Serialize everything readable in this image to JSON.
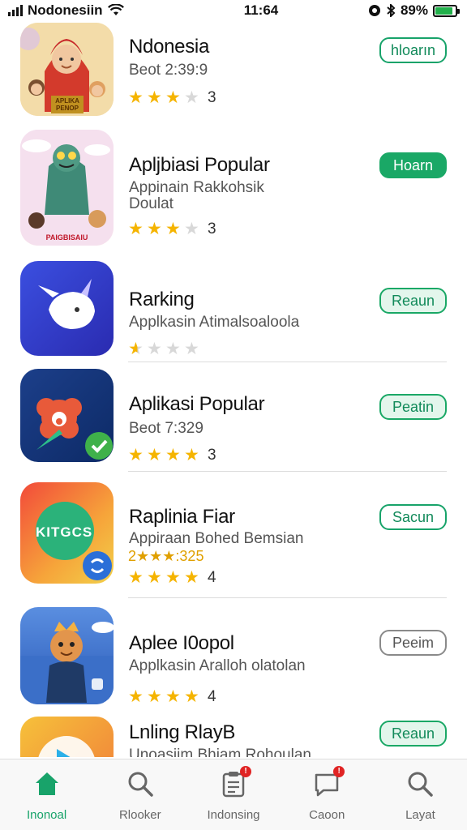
{
  "status_bar": {
    "carrier": "Nodonesiin",
    "time": "11:64",
    "battery": "89%"
  },
  "apps": [
    {
      "title": "Ndonesia",
      "subtitle": "Beot 2:39:9",
      "rating": "3",
      "stars_filled": 3,
      "action_label": "hloarın",
      "icon_text": "APLIKA\nPENOP"
    },
    {
      "title": "Apljbiasi Popular",
      "subtitle": "Appinain Rakkohsik\nDoulat",
      "rating": "3",
      "stars_filled": 3,
      "action_label": "Hoarn",
      "icon_text": "PAIGBISAIU"
    },
    {
      "title": "Rarking",
      "subtitle": "Applkasin Atimalsoaloola",
      "rating": "",
      "stars_filled": 0.5,
      "action_label": "Reaun",
      "icon_text": ""
    },
    {
      "title": "Aplikasi Popular",
      "subtitle": "Beot 7:329",
      "rating": "3",
      "stars_filled": 4,
      "action_label": "Peatin",
      "icon_text": ""
    },
    {
      "title": "Raplinia Fiar",
      "subtitle": "Appiraan Bohed Bemsian",
      "sub_rating": "2★★★:325",
      "rating": "4",
      "stars_filled": 4,
      "action_label": "Sacun",
      "icon_text": "KITGCS"
    },
    {
      "title": "Aplee I0opol",
      "subtitle": "Applkasin Aralloh olatolan",
      "rating": "4",
      "stars_filled": 4,
      "action_label": "Peeim",
      "icon_text": ""
    },
    {
      "title": "Lnling RlayB",
      "subtitle": "Unoasiim Bhiam Rohoulan",
      "rating": "",
      "stars_filled": 0,
      "action_label": "Reaun",
      "icon_text": ""
    }
  ],
  "tabs": [
    {
      "label": "Inonoal",
      "icon": "home-icon",
      "active": true,
      "badge": false
    },
    {
      "label": "Rlooker",
      "icon": "search-icon",
      "active": false,
      "badge": false
    },
    {
      "label": "Indonsing",
      "icon": "clipboard-icon",
      "active": false,
      "badge": true
    },
    {
      "label": "Caoon",
      "icon": "message-icon",
      "active": false,
      "badge": true
    },
    {
      "label": "Layat",
      "icon": "search-icon",
      "active": false,
      "badge": false
    }
  ],
  "colors": {
    "accent": "#1aa866",
    "star": "#f5b400"
  }
}
